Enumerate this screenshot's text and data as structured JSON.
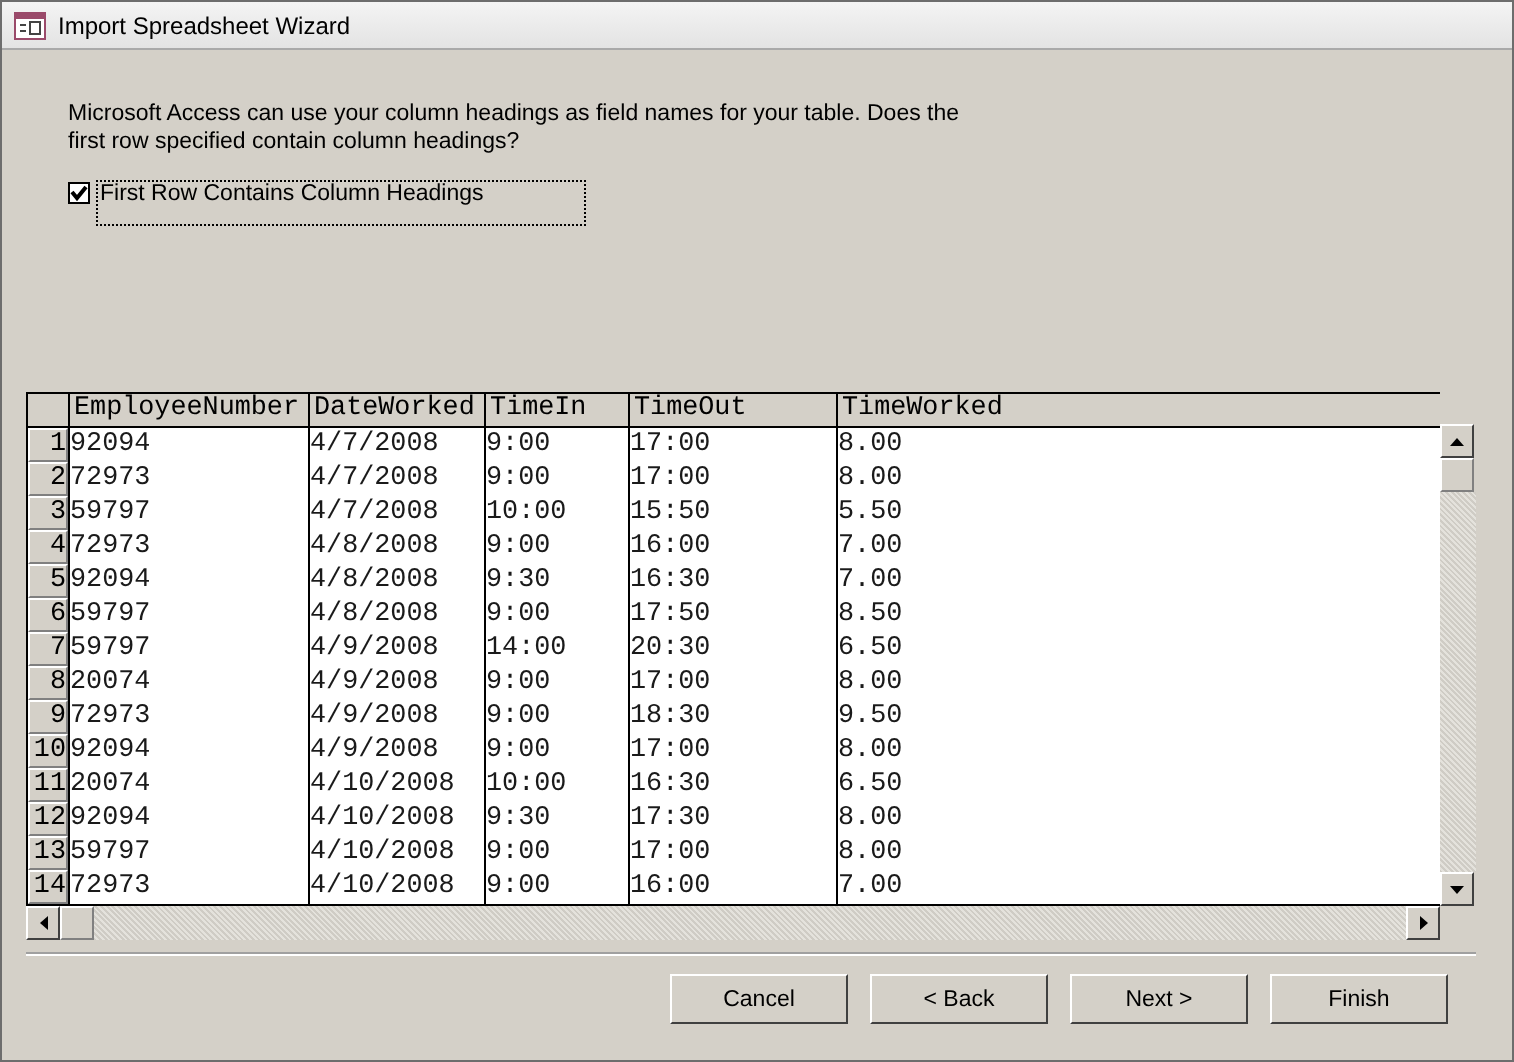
{
  "window": {
    "title": "Import Spreadsheet Wizard"
  },
  "instructions": "Microsoft Access can use your column headings as field names for your table. Does the first row specified contain column headings?",
  "first_row_headings": {
    "label": "First Row Contains Column Headings",
    "checked": true
  },
  "table": {
    "columns": [
      "EmployeeNumber",
      "DateWorked",
      "TimeIn",
      "TimeOut",
      "TimeWorked"
    ],
    "rows": [
      {
        "number": "1",
        "cells": [
          "92094",
          "4/7/2008",
          "9:00",
          "17:00",
          "8.00"
        ]
      },
      {
        "number": "2",
        "cells": [
          "72973",
          "4/7/2008",
          "9:00",
          "17:00",
          "8.00"
        ]
      },
      {
        "number": "3",
        "cells": [
          "59797",
          "4/7/2008",
          "10:00",
          "15:50",
          "5.50"
        ]
      },
      {
        "number": "4",
        "cells": [
          "72973",
          "4/8/2008",
          "9:00",
          "16:00",
          "7.00"
        ]
      },
      {
        "number": "5",
        "cells": [
          "92094",
          "4/8/2008",
          "9:30",
          "16:30",
          "7.00"
        ]
      },
      {
        "number": "6",
        "cells": [
          "59797",
          "4/8/2008",
          "9:00",
          "17:50",
          "8.50"
        ]
      },
      {
        "number": "7",
        "cells": [
          "59797",
          "4/9/2008",
          "14:00",
          "20:30",
          "6.50"
        ]
      },
      {
        "number": "8",
        "cells": [
          "20074",
          "4/9/2008",
          "9:00",
          "17:00",
          "8.00"
        ]
      },
      {
        "number": "9",
        "cells": [
          "72973",
          "4/9/2008",
          "9:00",
          "18:30",
          "9.50"
        ]
      },
      {
        "number": "10",
        "cells": [
          "92094",
          "4/9/2008",
          "9:00",
          "17:00",
          "8.00"
        ]
      },
      {
        "number": "11",
        "cells": [
          "20074",
          "4/10/2008",
          "10:00",
          "16:30",
          "6.50"
        ]
      },
      {
        "number": "12",
        "cells": [
          "92094",
          "4/10/2008",
          "9:30",
          "17:30",
          "8.00"
        ]
      },
      {
        "number": "13",
        "cells": [
          "59797",
          "4/10/2008",
          "9:00",
          "17:00",
          "8.00"
        ]
      },
      {
        "number": "14",
        "cells": [
          "72973",
          "4/10/2008",
          "9:00",
          "16:00",
          "7.00"
        ]
      }
    ]
  },
  "buttons": [
    "Cancel",
    "< Back",
    "Next >",
    "Finish"
  ]
}
